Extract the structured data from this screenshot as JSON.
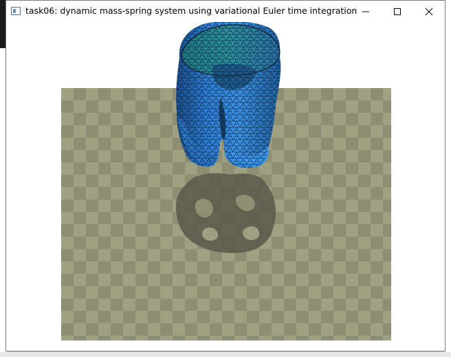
{
  "window": {
    "title": "task06: dynamic mass-spring system using variational Euler time integration",
    "controls": {
      "minimize_icon": "minimize-icon",
      "maximize_icon": "maximize-icon",
      "close_icon": "close-icon"
    }
  },
  "scene": {
    "floor_colors": [
      "#a0a083",
      "#8e8e72"
    ],
    "mesh_color": "#2f7fd6",
    "shadow_color": "#5a5a4c"
  }
}
